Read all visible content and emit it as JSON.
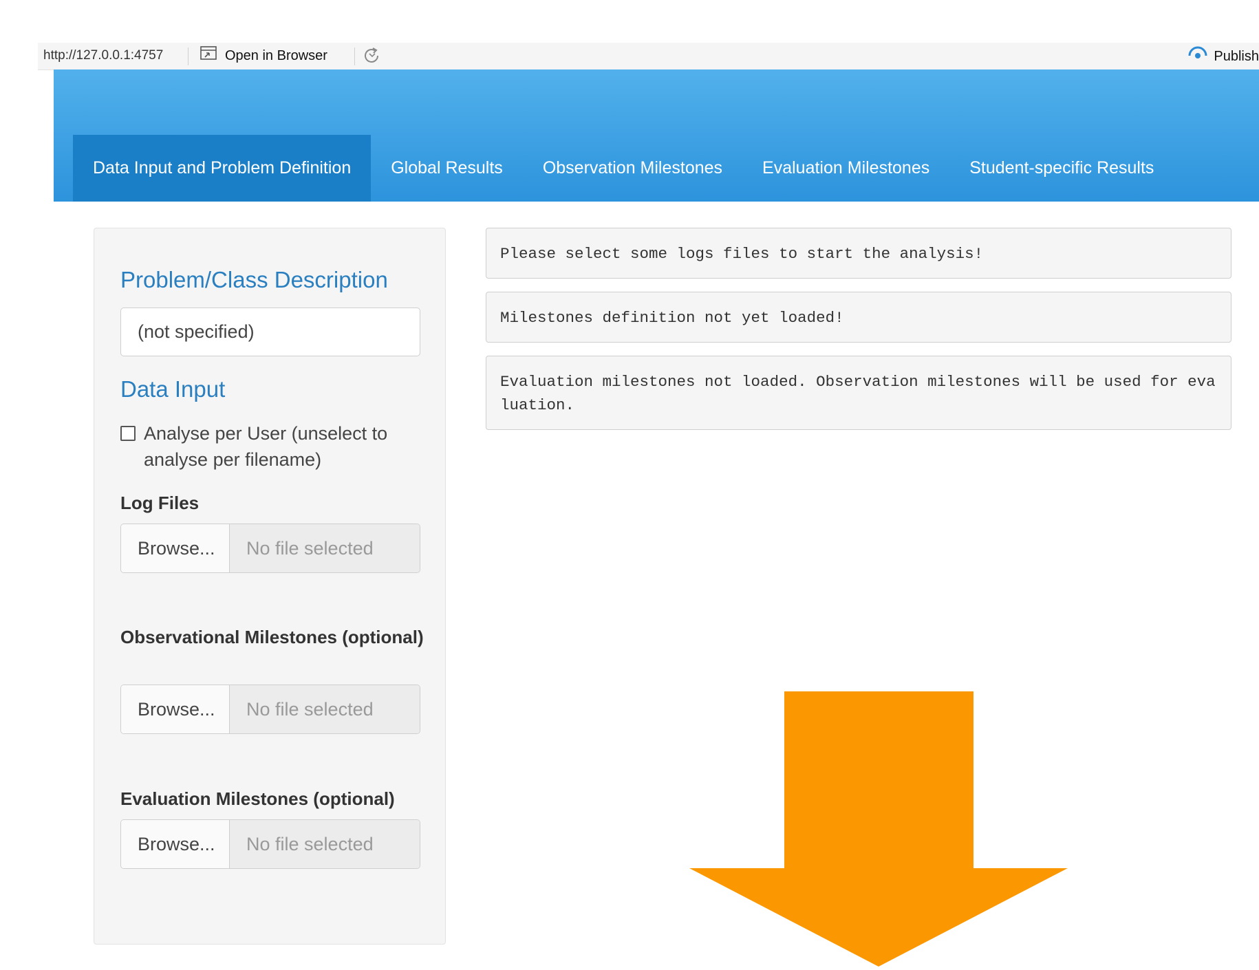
{
  "toolbar": {
    "url": "http://127.0.0.1:4757",
    "open_in_browser": "Open in Browser",
    "publish": "Publish"
  },
  "nav": {
    "tabs": [
      {
        "label": "Data Input and Problem Definition",
        "active": true
      },
      {
        "label": "Global Results",
        "active": false
      },
      {
        "label": "Observation Milestones",
        "active": false
      },
      {
        "label": "Evaluation Milestones",
        "active": false
      },
      {
        "label": "Student-specific Results",
        "active": false
      }
    ]
  },
  "sidebar": {
    "problem_title": "Problem/Class Description",
    "problem_value": "(not specified)",
    "data_input_title": "Data Input",
    "analyse_per_user": {
      "label": "Analyse per User (unselect to analyse per filename)",
      "checked": false
    },
    "log_files": {
      "label": "Log Files",
      "browse": "Browse...",
      "status": "No file selected"
    },
    "observational": {
      "label": "Observational Milestones (optional)",
      "browse": "Browse...",
      "status": "No file selected"
    },
    "evaluation": {
      "label": "Evaluation Milestones (optional)",
      "browse": "Browse...",
      "status": "No file selected"
    }
  },
  "messages": [
    "Please select some logs files to start the analysis!",
    "Milestones definition not yet loaded!",
    "Evaluation milestones not loaded. Observation milestones will be used for evaluation."
  ],
  "colors": {
    "header_blue": "#3aa0e4",
    "active_tab": "#1a7fc6",
    "title_blue": "#2a7fc0",
    "arrow_orange": "#fb9700"
  },
  "icons": [
    "open-in-browser-icon",
    "refresh-icon",
    "publish-icon",
    "arrow-down-icon"
  ]
}
